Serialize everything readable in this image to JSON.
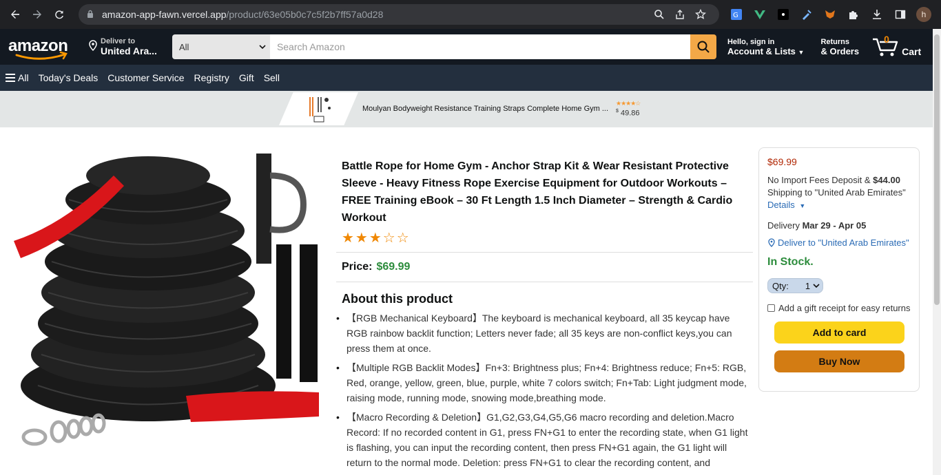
{
  "browser": {
    "url_host": "amazon-app-fawn.vercel.app",
    "url_path": "/product/63e05b0c7c5f2b7ff57a0d28",
    "profile_initial": "h"
  },
  "header": {
    "logo": "amazon",
    "deliver_line1": "Deliver to",
    "deliver_line2": "United Ara...",
    "search_category": "All",
    "search_placeholder": "Search Amazon",
    "account_line1": "Hello, sign in",
    "account_line2": "Account & Lists",
    "returns_line1": "Returns",
    "returns_line2": "& Orders",
    "cart_count": "0",
    "cart_label": "Cart"
  },
  "subnav": {
    "all": "All",
    "items": [
      "Today's Deals",
      "Customer Service",
      "Registry",
      "Gift",
      "Sell"
    ]
  },
  "ad": {
    "title": "Moulyan Bodyweight Resistance Training Straps Complete Home Gym ...",
    "stars": "★★★★☆",
    "currency": "$",
    "price": "49.86"
  },
  "product": {
    "title": "Battle Rope for Home Gym - Anchor Strap Kit & Wear Resistant Protective Sleeve - Heavy Fitness Rope Exercise Equipment for Outdoor Workouts – FREE Training eBook – 30 Ft Length 1.5 Inch Diameter – Strength & Cardio Workout",
    "stars": "★★★☆☆",
    "price_label": "Price:",
    "price": "$69.99",
    "about_heading": "About this product",
    "bullets": [
      "【RGB Mechanical Keyboard】The keyboard is mechanical keyboard, all 35 keycap have RGB rainbow backlit function; Letters never fade; all 35 keys are non-conflict keys,you can press them at once.",
      "【Multiple RGB Backlit Modes】Fn+3: Brightness plus; Fn+4: Brightness reduce; Fn+5: RGB, Red, orange, yellow, green, blue, purple, white 7 colors switch; Fn+Tab: Light judgment mode, raising mode, running mode, snowing mode,breathing mode.",
      "【Macro Recording & Deletion】G1,G2,G3,G4,G5,G6 macro recording and deletion.Macro Record: If no recorded content in G1, press FN+G1 to enter the recording state, when G1 light is flashing, you can input the recording content, then press FN+G1 again, the G1 light will return to the normal mode. Deletion: press FN+G1 to clear the recording content, and"
    ]
  },
  "buybox": {
    "price": "$69.99",
    "import_fees_text": "No Import Fees Deposit & ",
    "import_fees_amount": "$44.00",
    "shipping_text": "Shipping to \"United Arab Emirates\"",
    "details_link": "Details",
    "delivery_label": "Delivery ",
    "delivery_dates": "Mar 29 - Apr 05",
    "deliver_to": "Deliver to \"United Arab Emirates\"",
    "stock": "In Stock.",
    "qty_label": "Qty:",
    "qty_value": "1",
    "gift_text": "Add a gift receipt for easy returns",
    "add_to_cart": "Add to card",
    "buy_now": "Buy Now"
  },
  "colors": {
    "header_bg": "#131921",
    "subnav_bg": "#232f3e",
    "search_button": "#f3a847",
    "price_green": "#2c8c3c",
    "price_red": "#b12704",
    "add_to_cart": "#fbd31b",
    "buy_now": "#d37c13"
  }
}
